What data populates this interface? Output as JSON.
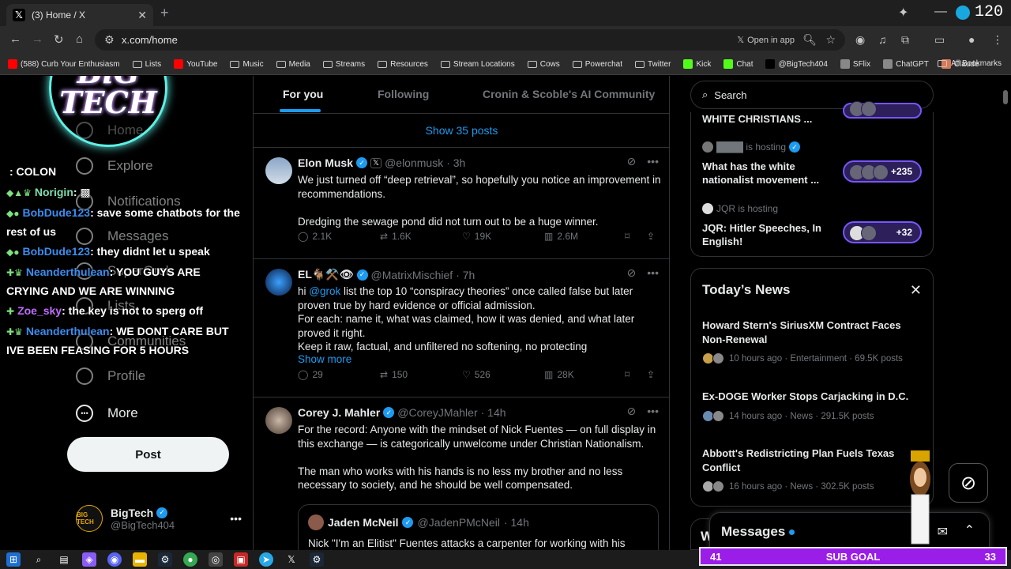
{
  "browser": {
    "tab_title": "(3) Home / X",
    "url": "x.com/home",
    "open_in_app": "Open in app",
    "fps_value": "120"
  },
  "bookmarks": [
    {
      "label": "(588) Curb Your Enthusiasm",
      "kind": "yt"
    },
    {
      "label": "Lists",
      "kind": "folder"
    },
    {
      "label": "YouTube",
      "kind": "yt"
    },
    {
      "label": "Music",
      "kind": "folder"
    },
    {
      "label": "Media",
      "kind": "folder"
    },
    {
      "label": "Streams",
      "kind": "folder"
    },
    {
      "label": "Resources",
      "kind": "folder"
    },
    {
      "label": "Stream Locations",
      "kind": "folder"
    },
    {
      "label": "Cows",
      "kind": "folder"
    },
    {
      "label": "Powerchat",
      "kind": "folder"
    },
    {
      "label": "Twitter",
      "kind": "folder"
    },
    {
      "label": "Kick",
      "kind": "kick"
    },
    {
      "label": "Chat",
      "kind": "kick"
    },
    {
      "label": "@BigTech404",
      "kind": "x"
    },
    {
      "label": "SFlix",
      "kind": "other"
    },
    {
      "label": "ChatGPT",
      "kind": "other"
    },
    {
      "label": "Claude",
      "kind": "claude"
    }
  ],
  "all_bookmarks": "All Bookmarks",
  "logo": {
    "line1": "BiG",
    "line2": "TECH"
  },
  "nav": {
    "items": [
      "Home",
      "Explore",
      "Notifications",
      "Messages",
      "SuperGrok",
      "Lists",
      "Communities",
      "Profile"
    ],
    "more": "More",
    "post_button": "Post"
  },
  "account": {
    "name": "BigTech",
    "handle": "@BigTech404",
    "avatar": "BIG TECH"
  },
  "chat": [
    {
      "user": "",
      "badges": "",
      "color": "#ffcc00",
      "msg": ": COLON"
    },
    {
      "user": "Norigin",
      "badges": "◆▲♛",
      "color": "#7ee0b0",
      "msg": ": ▩"
    },
    {
      "user": "BobDude123",
      "badges": "◆●",
      "color": "#3b8df0",
      "msg": ": save some chatbots for the rest of us"
    },
    {
      "user": "BobDude123",
      "badges": "◆●",
      "color": "#3b8df0",
      "msg": ": they didnt let u speak"
    },
    {
      "user": "Neanderthulean",
      "badges": "✚♛",
      "color": "#3b8df0",
      "msg": ": YOU GUYS ARE CRYING AND WE ARE WINNING"
    },
    {
      "user": "Zoe_sky",
      "badges": "✚",
      "color": "#c06cff",
      "msg": ": the key is not to sperg off"
    },
    {
      "user": "Neanderthulean",
      "badges": "✚♛",
      "color": "#3b8df0",
      "msg": ": WE DONT CARE BUT IVE BEEN FEASING FOR 5 HOURS"
    }
  ],
  "feed": {
    "tabs": [
      "For you",
      "Following",
      "Cronin & Scoble's AI Community"
    ],
    "show_posts": "Show 35 posts",
    "posts": [
      {
        "name": "Elon Musk",
        "handle": "@elonmusk",
        "time": "· 3h",
        "text": "We just turned off “deep retrieval”, so hopefully you notice an improvement in recommendations.\n\nDredging the sewage pond did not turn out to be a huge winner.",
        "replies": "2.1K",
        "reposts": "1.6K",
        "likes": "19K",
        "views": "2.6M"
      },
      {
        "name": "EL🐐⚒️👁",
        "handle": "@MatrixMischief",
        "time": "· 7h",
        "mention": "@grok",
        "text": " list the top 10 “conspiracy theories” once called false but later proven true by hard evidence or official admission.\nFor each: name it, what was claimed, how it was denied, and what later proved it right.\nKeep it raw, factual, and unfiltered no softening, no protecting",
        "prefix": "hi ",
        "show_more": "Show more",
        "replies": "29",
        "reposts": "150",
        "likes": "526",
        "views": "28K"
      },
      {
        "name": "Corey J. Mahler",
        "handle": "@CoreyJMahler",
        "time": "· 14h",
        "text": "For the record: Anyone with the mindset of Nick Fuentes — on full display in this exchange — is categorically unwelcome under Christian Nationalism.\n\nThe man who works with his hands is no less my brother and no less necessary to society, and he should be well compensated.",
        "quote": {
          "name": "Jaden McNeil",
          "handle": "@JadenPMcNeil",
          "time": "· 14h",
          "text": "Nick \"I'm an Elitist\" Fuentes attacks a carpenter for working with his hands, going to community college, and \"banging nails\" for a living"
        }
      }
    ]
  },
  "right": {
    "search_placeholder": "Search",
    "spaces": [
      {
        "host": "",
        "title": "WHITE CHRISTIANS ...",
        "count": ""
      },
      {
        "host": "████ is hosting",
        "title": "What has the white nationalist movement ...",
        "count": "+235"
      },
      {
        "host": "JQR is hosting",
        "title": "JQR: Hitler Speeches, In English!",
        "count": "+32"
      }
    ],
    "news_title": "Today’s News",
    "news": [
      {
        "title": "Howard Stern's SiriusXM Contract Faces Non-Renewal",
        "meta": "10 hours ago · Entertainment · 69.5K posts"
      },
      {
        "title": "Ex-DOGE Worker Stops Carjacking in D.C.",
        "meta": "14 hours ago · News · 291.5K posts"
      },
      {
        "title": "Abbott's Redistricting Plan Fuels Texas Conflict",
        "meta": "16 hours ago · News · 302.5K posts"
      }
    ],
    "messages": "Messages",
    "partial_letter": "W"
  },
  "subgoal": {
    "left": "41",
    "label": "SUB GOAL",
    "right": "33"
  },
  "colors": {
    "accent": "#1d9bf0",
    "bg": "#000000",
    "border": "#2f3336",
    "muted": "#71767b",
    "subgoal": "#9b1ee8",
    "spaces_pill": "#7856ff"
  }
}
